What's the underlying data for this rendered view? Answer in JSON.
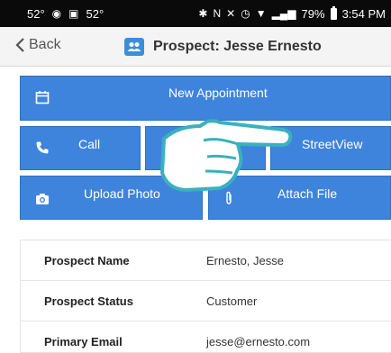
{
  "status_bar": {
    "left_temp_1": "52°",
    "left_temp_2": "52°",
    "battery_percent": "79%",
    "time": "3:54 PM",
    "icons": [
      "weather-icon",
      "nav-icon",
      "car-icon",
      "bluetooth-icon",
      "nfc-icon",
      "mute-icon",
      "alarm-icon",
      "wifi-icon",
      "signal-icon",
      "battery-icon"
    ]
  },
  "nav": {
    "back_label": "Back",
    "title": "Prospect: Jesse Ernesto",
    "title_icon": "people-icon"
  },
  "actions": {
    "new_appointment": "New Appointment",
    "call": "Call",
    "streetview": "StreetView",
    "upload_photo": "Upload Photo",
    "attach_file": "Attach File"
  },
  "details": [
    {
      "label": "Prospect Name",
      "value": "Ernesto, Jesse"
    },
    {
      "label": "Prospect Status",
      "value": "Customer"
    },
    {
      "label": "Primary Email",
      "value": "jesse@ernesto.com"
    }
  ],
  "colors": {
    "button_blue": "#3f84dc",
    "button_border": "#2f6fc0",
    "status_bar": "#0a0a0a",
    "nav_bar": "#f4f4f4",
    "hand_outline": "#3ab0c0"
  }
}
